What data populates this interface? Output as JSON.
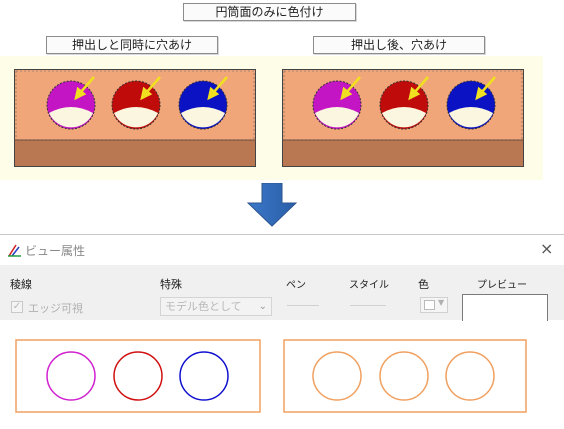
{
  "labels": {
    "top_title": "円筒面のみに色付け",
    "left_caption": "押出しと同時に穴あけ",
    "right_caption": "押出し後、穴あけ"
  },
  "dialog": {
    "title": "ビュー属性",
    "close": "×",
    "columns": {
      "edge": "稜線",
      "special": "特殊",
      "pen": "ペン",
      "style": "スタイル",
      "color": "色",
      "preview": "プレビュー"
    },
    "checkbox_label": "エッジ可視",
    "checkbox_mark": "✓",
    "select_value": "モデル色として",
    "select_chevron": "⌄"
  },
  "colors": {
    "box_fill": "#f1a679",
    "box_bottom": "#b97752",
    "magenta": "#c415c4",
    "red": "#c00b0b",
    "blue": "#0a12c4",
    "hole_inner": "#fbf6e0",
    "arrow": "#f0e020",
    "orange_outline": "#f0a060"
  }
}
